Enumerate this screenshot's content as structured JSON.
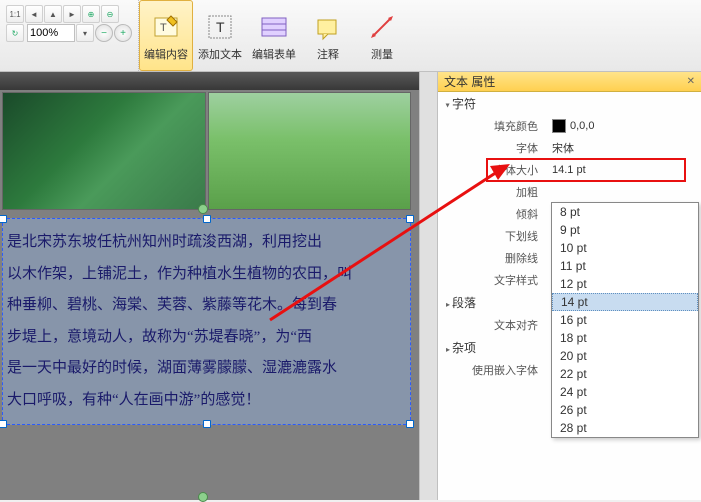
{
  "toolbar": {
    "zoom_value": "100%",
    "buttons": {
      "edit_content": "编辑内容",
      "add_text": "添加文本",
      "edit_form": "编辑表单",
      "annotate": "注释",
      "measure": "测量"
    }
  },
  "document": {
    "paragraphs": [
      "是北宋苏东坡任杭州知州时疏浚西湖，利用挖出",
      "以木作架，上铺泥土，作为种植水生植物的农田，叫",
      "种垂柳、碧桃、海棠、芙蓉、紫藤等花木。每到春",
      "步堤上，意境动人，故称为“苏堤春晓”，为“西",
      "是一天中最好的时候，湖面薄雾朦朦、湿漉漉露水",
      "大口呼吸，有种“人在画中游”的感觉！"
    ]
  },
  "panel": {
    "title": "文本 属性",
    "sections": {
      "char": "字符",
      "paragraph": "段落",
      "misc": "杂项"
    },
    "props": {
      "fill_color": {
        "label": "填充颜色",
        "value": "0,0,0"
      },
      "font": {
        "label": "字体",
        "value": "宋体"
      },
      "font_size": {
        "label": "字体大小",
        "value": "14.1 pt"
      },
      "bold": {
        "label": "加粗"
      },
      "italic": {
        "label": "倾斜"
      },
      "underline": {
        "label": "下划线"
      },
      "strike": {
        "label": "删除线"
      },
      "text_style": {
        "label": "文字样式"
      },
      "text_align": {
        "label": "文本对齐"
      },
      "embed_font": {
        "label": "使用嵌入字体"
      }
    }
  },
  "dropdown": {
    "items": [
      "8 pt",
      "9 pt",
      "10 pt",
      "11 pt",
      "12 pt",
      "14 pt",
      "16 pt",
      "18 pt",
      "20 pt",
      "22 pt",
      "24 pt",
      "26 pt",
      "28 pt"
    ],
    "selected": "14 pt"
  }
}
